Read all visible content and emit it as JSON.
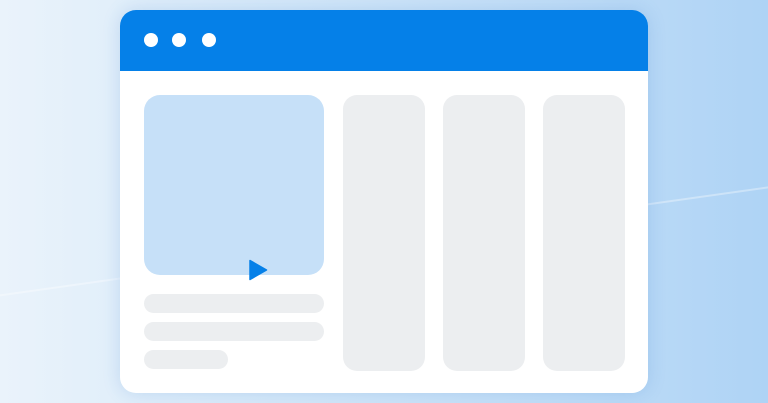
{
  "window": {
    "controls": [
      "window-dot",
      "window-dot",
      "window-dot"
    ]
  },
  "main": {
    "video": {
      "icon": "play-icon"
    },
    "text_lines": 3,
    "cards": 3
  },
  "colors": {
    "titlebar": "#0580e8",
    "play": "#0580e8",
    "video_bg": "#c6e0f8",
    "placeholder": "#eceef0",
    "window_bg": "#ffffff"
  }
}
